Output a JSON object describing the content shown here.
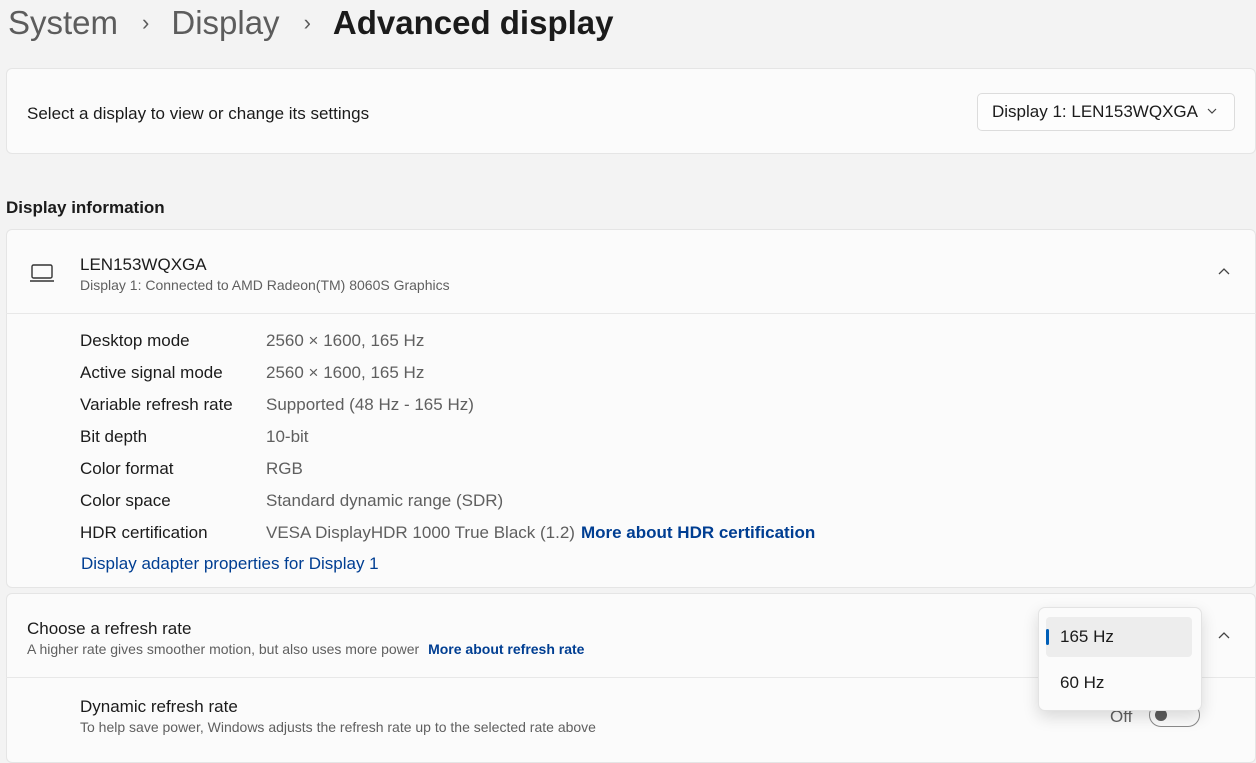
{
  "breadcrumb": {
    "items": [
      "System",
      "Display"
    ],
    "current": "Advanced display"
  },
  "select_display": {
    "label": "Select a display to view or change its settings",
    "selected": "Display 1: LEN153WQXGA"
  },
  "display_info": {
    "section_title": "Display information",
    "monitor_name": "LEN153WQXGA",
    "monitor_desc": "Display 1: Connected to AMD Radeon(TM) 8060S Graphics",
    "rows": [
      {
        "label": "Desktop mode",
        "value": "2560 × 1600, 165 Hz"
      },
      {
        "label": "Active signal mode",
        "value": "2560 × 1600, 165 Hz"
      },
      {
        "label": "Variable refresh rate",
        "value": "Supported (48 Hz - 165 Hz)"
      },
      {
        "label": "Bit depth",
        "value": "10-bit"
      },
      {
        "label": "Color format",
        "value": "RGB"
      },
      {
        "label": "Color space",
        "value": "Standard dynamic range (SDR)"
      },
      {
        "label": "HDR certification",
        "value": "VESA DisplayHDR 1000 True Black (1.2)"
      }
    ],
    "hdr_link": "More about HDR certification",
    "adapter_link": "Display adapter properties for Display 1"
  },
  "refresh_rate": {
    "title": "Choose a refresh rate",
    "desc": "A higher rate gives smoother motion, but also uses more power",
    "link": "More about refresh rate",
    "options": [
      "165 Hz",
      "60 Hz"
    ],
    "selected_index": 0
  },
  "dynamic_refresh": {
    "title": "Dynamic refresh rate",
    "desc": "To help save power, Windows adjusts the refresh rate up to the selected rate above",
    "state": "Off"
  }
}
